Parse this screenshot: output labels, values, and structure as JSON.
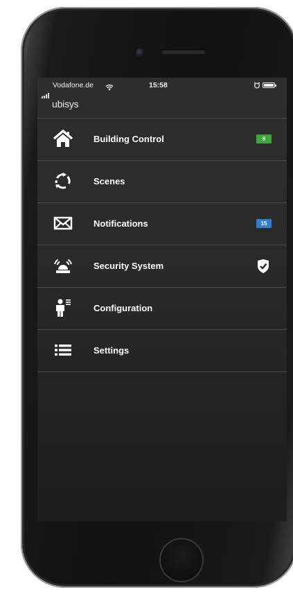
{
  "status_bar": {
    "carrier": "Vodafone.de",
    "time": "15:58"
  },
  "app": {
    "brand": "ubisys"
  },
  "menu": {
    "items": [
      {
        "label": "Building Control",
        "icon": "house-icon",
        "badge": "8",
        "badge_color": "#3da63a"
      },
      {
        "label": "Scenes",
        "icon": "circular-arrows-icon"
      },
      {
        "label": "Notifications",
        "icon": "envelope-icon",
        "badge": "15",
        "badge_color": "#2f7fd0"
      },
      {
        "label": "Security System",
        "icon": "alarm-siren-icon",
        "status_icon": "shield-check-icon"
      },
      {
        "label": "Configuration",
        "icon": "person-list-icon"
      },
      {
        "label": "Settings",
        "icon": "list-icon"
      }
    ]
  },
  "colors": {
    "screen_background": "#2a2a2a",
    "divider": "#4a4a4a",
    "badge_green": "#3da63a",
    "badge_blue": "#2f7fd0"
  }
}
